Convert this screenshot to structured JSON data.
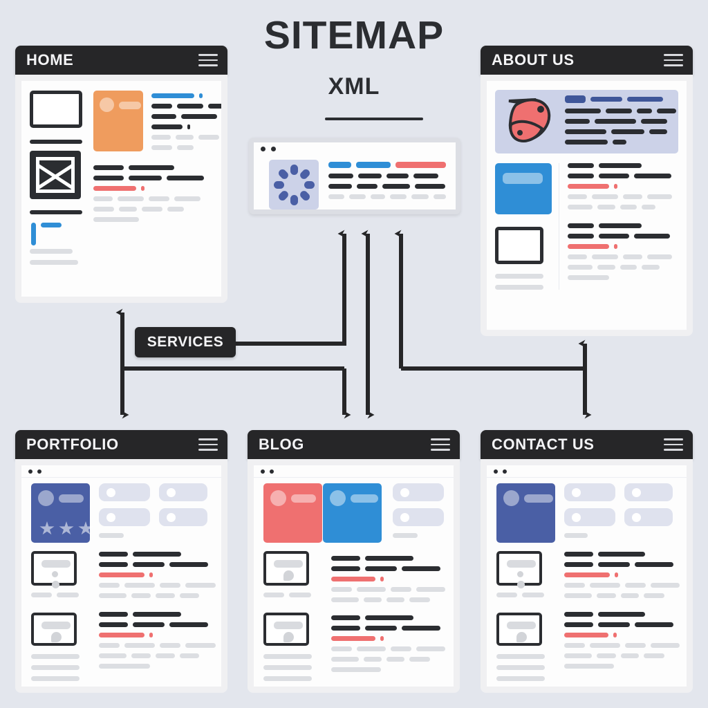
{
  "header": {
    "title": "SITEMAP",
    "subtitle": "XML"
  },
  "colors": {
    "background": "#e3e6ed",
    "bar_dark": "#262628",
    "text_dark": "#2b2d31",
    "accent_blue": "#2f8ed6",
    "accent_red": "#ef7070",
    "accent_orange": "#ef9c5e",
    "accent_navy": "#3f5699",
    "hero_lavender": "#ccd2e8",
    "line_gray": "#dcdee2"
  },
  "connector_label": {
    "text": "SERVICES"
  },
  "cards": [
    {
      "id": "home",
      "title": "HOME",
      "menu_icon": "hamburger-icon",
      "position": "top-left",
      "features": [
        "wireframe-box",
        "image-placeholder-x",
        "blue-marker",
        "orange-media-tile",
        "text-lines"
      ]
    },
    {
      "id": "about-us",
      "title": "ABOUT US",
      "menu_icon": "hamburger-icon",
      "position": "top-right",
      "features": [
        "lavender-hero-banner",
        "red-blob-illustration",
        "blue-media-tile",
        "outlined-thumbnail",
        "text-lines"
      ]
    },
    {
      "id": "portfolio",
      "title": "PORTFOLIO",
      "menu_icon": "hamburger-icon",
      "position": "bottom-left",
      "features": [
        "navy-profile-tile",
        "three-stars",
        "two-thumbnails",
        "tag-pills",
        "text-lines"
      ]
    },
    {
      "id": "blog",
      "title": "BLOG",
      "menu_icon": "hamburger-icon",
      "position": "bottom-center",
      "features": [
        "red-media-tile",
        "blue-media-tile",
        "two-thumbnails",
        "tag-pills",
        "text-lines"
      ]
    },
    {
      "id": "contact-us",
      "title": "CONTACT US",
      "menu_icon": "hamburger-icon",
      "position": "bottom-right",
      "features": [
        "navy-profile-tile",
        "two-thumbnails",
        "tag-pills",
        "text-lines"
      ]
    }
  ],
  "xml_card": {
    "id": "xml-node",
    "dots": 2,
    "thumbnail_icon": "loading-spinner-icon",
    "spinner_petals": 8
  },
  "diagram_data": {
    "type": "sitemap",
    "root": "SITEMAP XML",
    "hub_label": "SERVICES",
    "nodes": [
      "HOME",
      "ABOUT US",
      "XML",
      "SERVICES",
      "PORTFOLIO",
      "BLOG",
      "CONTACT US"
    ],
    "edges": [
      {
        "from": "SERVICES",
        "to": "XML",
        "arrow": "single-up"
      },
      {
        "from": "SERVICES",
        "to": "HOME",
        "arrow": "double"
      },
      {
        "from": "SERVICES",
        "to": "PORTFOLIO",
        "arrow": "double"
      },
      {
        "from": "SERVICES",
        "to": "BLOG",
        "arrow": "double"
      },
      {
        "from": "XML",
        "to": "BLOG",
        "arrow": "double"
      },
      {
        "from": "XML",
        "to": "ABOUT US",
        "arrow": "single-up"
      },
      {
        "from": "ABOUT US",
        "to": "CONTACT US",
        "arrow": "double"
      }
    ]
  }
}
